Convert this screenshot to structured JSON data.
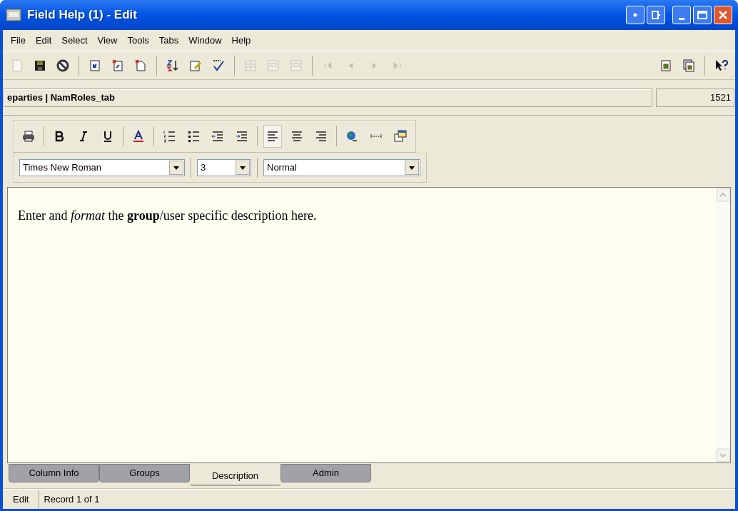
{
  "window": {
    "title": "Field Help (1) - Edit"
  },
  "menu": [
    "File",
    "Edit",
    "Select",
    "View",
    "Tools",
    "Tabs",
    "Window",
    "Help"
  ],
  "toolbar": [
    {
      "kind": "new",
      "disabled": true
    },
    {
      "kind": "save",
      "disabled": false
    },
    {
      "kind": "cancel",
      "disabled": false
    },
    {
      "kind": "sep"
    },
    {
      "kind": "page",
      "disabled": false
    },
    {
      "kind": "page-x",
      "disabled": false
    },
    {
      "kind": "doc-x",
      "disabled": false
    },
    {
      "kind": "sep"
    },
    {
      "kind": "sort",
      "disabled": false
    },
    {
      "kind": "note",
      "disabled": false
    },
    {
      "kind": "spell",
      "disabled": false
    },
    {
      "kind": "sep"
    },
    {
      "kind": "grid",
      "disabled": true
    },
    {
      "kind": "form",
      "disabled": true
    },
    {
      "kind": "form",
      "disabled": true
    },
    {
      "kind": "sep"
    },
    {
      "kind": "first",
      "disabled": true
    },
    {
      "kind": "prev",
      "disabled": true
    },
    {
      "kind": "next",
      "disabled": true
    },
    {
      "kind": "last",
      "disabled": true
    },
    {
      "kind": "spacer"
    },
    {
      "kind": "doc-green",
      "disabled": false
    },
    {
      "kind": "docs-green",
      "disabled": false
    },
    {
      "kind": "sep"
    },
    {
      "kind": "help",
      "disabled": false
    }
  ],
  "record_bar": {
    "path": "eparties | NamRoles_tab",
    "count": "1521"
  },
  "format_toolbar": [
    {
      "kind": "print",
      "selected": false
    },
    {
      "kind": "sep"
    },
    {
      "kind": "bold",
      "selected": false
    },
    {
      "kind": "italic",
      "selected": false
    },
    {
      "kind": "underline",
      "selected": false
    },
    {
      "kind": "sep"
    },
    {
      "kind": "color",
      "selected": false
    },
    {
      "kind": "sep"
    },
    {
      "kind": "ol",
      "selected": false
    },
    {
      "kind": "ul",
      "selected": false
    },
    {
      "kind": "outdent",
      "selected": false
    },
    {
      "kind": "indent",
      "selected": false
    },
    {
      "kind": "sep"
    },
    {
      "kind": "left",
      "selected": true
    },
    {
      "kind": "center",
      "selected": false
    },
    {
      "kind": "right",
      "selected": false
    },
    {
      "kind": "sep"
    },
    {
      "kind": "globe",
      "selected": false
    },
    {
      "kind": "rule",
      "selected": false
    },
    {
      "kind": "window",
      "selected": false
    }
  ],
  "font": {
    "family": "Times New Roman",
    "size": "3",
    "style": "Normal"
  },
  "editor": {
    "text": "Enter and *format* the **group**/user specific description here."
  },
  "tabs": [
    {
      "label": "Column Info",
      "selected": false
    },
    {
      "label": "Groups",
      "selected": false
    },
    {
      "label": "Description",
      "selected": true
    },
    {
      "label": "Admin",
      "selected": false
    }
  ],
  "status_bar": {
    "mode": "Edit",
    "record": "Record 1 of 1"
  }
}
